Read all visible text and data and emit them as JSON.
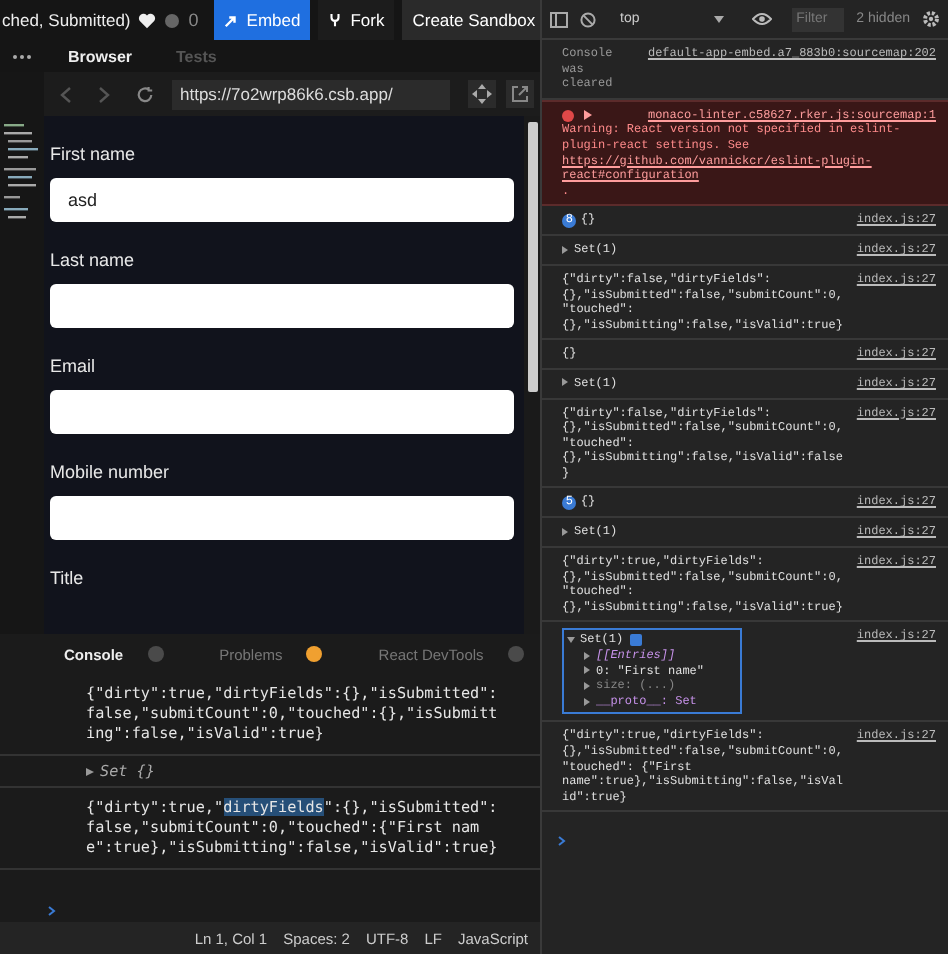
{
  "header": {
    "title": "ched, Submitted)",
    "like_count": "0",
    "buttons": [
      {
        "label": "Embed",
        "kind": "primary"
      },
      {
        "label": "Fork",
        "kind": "fork"
      },
      {
        "label": "Create Sandbox",
        "kind": "plain"
      }
    ]
  },
  "preview_tabs": [
    {
      "label": "Browser",
      "selected": true
    },
    {
      "label": "Tests",
      "selected": false
    }
  ],
  "address_bar": {
    "url": "https://7o2wrp86k6.csb.app/"
  },
  "form": {
    "fields": [
      {
        "label": "First name",
        "kind": "input",
        "value": "asd"
      },
      {
        "label": "Last name",
        "kind": "input"
      },
      {
        "label": "Email",
        "kind": "input"
      },
      {
        "label": "Mobile number",
        "kind": "input"
      },
      {
        "label": "Title",
        "kind": "label"
      }
    ]
  },
  "console_tabs": [
    {
      "label": "Console",
      "selected": true,
      "color": "#4a4a4a"
    },
    {
      "label": "Problems",
      "selected": false,
      "color": "#f0a030"
    },
    {
      "label": "React DevTools",
      "selected": false,
      "color": "#4a4a4a"
    }
  ],
  "console_log": [
    {
      "kind": "text",
      "parts": [
        {
          "text": "{\"dirty\":true,\"dirtyFields\":{},\"isSubmitted\":false,\"submitCount\":0,\"touched\":{},\"isSubmitting\":false,\"isValid\":true}",
          "highlighted": false
        }
      ]
    },
    {
      "kind": "set",
      "text": "Set {}",
      "expanded": false
    },
    {
      "kind": "text",
      "parts": [
        {
          "text": "{\"dirty\":true,\"",
          "highlighted": false
        },
        {
          "text": "dirtyFields",
          "highlighted": true
        },
        {
          "text": "\":{},\"isSubmitted\":false,\"submitCount\":0,\"touched\":{\"First name\":true},\"isSubmitting\":false,\"isValid\":true}",
          "highlighted": false
        }
      ]
    }
  ],
  "status_bar": [
    "Ln 1, Col 1",
    "Spaces: 2",
    "UTF-8",
    "LF",
    "JavaScript"
  ],
  "devtools": {
    "context": "top",
    "filter": {
      "placeholder": "Filter"
    },
    "hidden_count": "2 hidden",
    "messages": [
      {
        "kind": "cleared",
        "text": "Console was cleared",
        "source": "default-app-embed.a7_883b0:sourcemap:202"
      },
      {
        "kind": "error",
        "source": "monaco-linter.c58627.rker.js:sourcemap:1",
        "text": "Warning: React version not specified in eslint-plugin-react settings. See ",
        "link": "https://github.com/vannickcr/eslint-plugin-react#configuration",
        "tail": " ."
      },
      {
        "kind": "log",
        "count": "8",
        "text": "{}",
        "source": "index.js:27"
      },
      {
        "kind": "set",
        "text": "Set(1)",
        "source": "index.js:27",
        "expanded": false
      },
      {
        "kind": "log",
        "text": "{\"dirty\":false,\"dirtyFields\": {},\"isSubmitted\":false,\"submitCount\":0,\"touched\": {},\"isSubmitting\":false,\"isValid\":true}",
        "source": "index.js:27"
      },
      {
        "kind": "log",
        "text": "{}",
        "source": "index.js:27"
      },
      {
        "kind": "set",
        "text": "Set(1)",
        "source": "index.js:27",
        "expanded": false
      },
      {
        "kind": "log",
        "text": "{\"dirty\":false,\"dirtyFields\": {},\"isSubmitted\":false,\"submitCount\":0,\"touched\": {},\"isSubmitting\":false,\"isValid\":false}",
        "source": "index.js:27"
      },
      {
        "kind": "log",
        "count": "5",
        "text": "{}",
        "source": "index.js:27"
      },
      {
        "kind": "set",
        "text": "Set(1)",
        "source": "index.js:27",
        "expanded": false
      },
      {
        "kind": "log",
        "text": "{\"dirty\":true,\"dirtyFields\": {},\"isSubmitted\":false,\"submitCount\":0,\"touched\": {},\"isSubmitting\":false,\"isValid\":true}",
        "source": "index.js:27"
      },
      {
        "kind": "set",
        "text": "Set(1)",
        "source": "index.js:27",
        "expanded": true,
        "children": [
          {
            "kind": "group",
            "text": "[[Entries]]"
          },
          {
            "kind": "entry",
            "text": "0: \"First name\""
          },
          {
            "kind": "getter",
            "text": "size: (...)"
          },
          {
            "kind": "proto",
            "text": "__proto__: Set"
          }
        ]
      },
      {
        "kind": "log",
        "text": "{\"dirty\":true,\"dirtyFields\": {},\"isSubmitted\":false,\"submitCount\":0,\"touched\": {\"First name\":true},\"isSubmitting\":false,\"isValid\":true}",
        "source": "index.js:27"
      }
    ]
  }
}
